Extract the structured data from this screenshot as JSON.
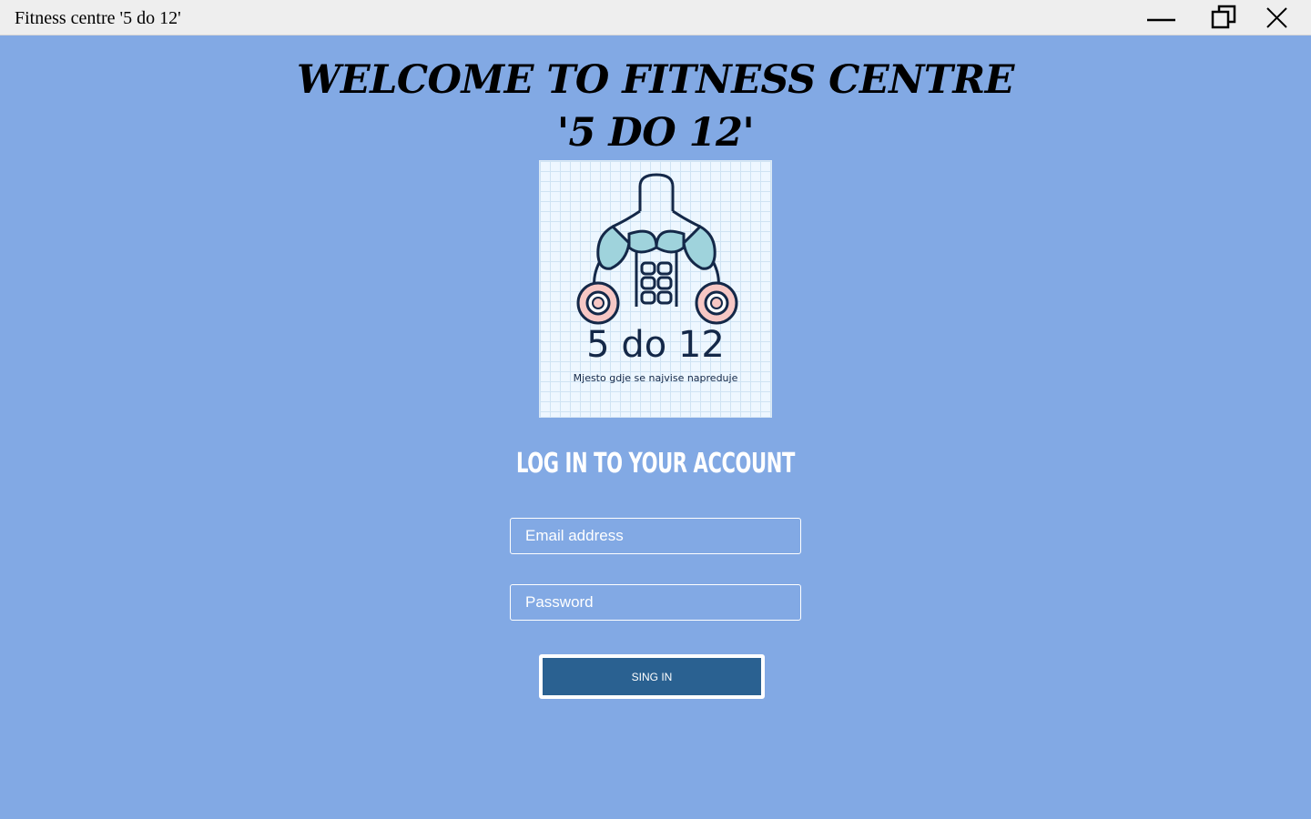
{
  "window": {
    "title": "Fitness centre '5 do 12'"
  },
  "welcome": {
    "line1": "WELCOME TO FITNESS CENTRE",
    "line2": "'5 DO 12'"
  },
  "logo": {
    "title": "5 do 12",
    "subtitle": "Mjesto gdje se najvise napreduje"
  },
  "login": {
    "heading": "LOG IN TO YOUR ACCOUNT",
    "email_placeholder": "Email address",
    "password_placeholder": "Password",
    "submit_label": "SING IN"
  },
  "colors": {
    "background": "#82a9e4",
    "button": "#2a6191",
    "titlebar": "#eeeeee"
  }
}
